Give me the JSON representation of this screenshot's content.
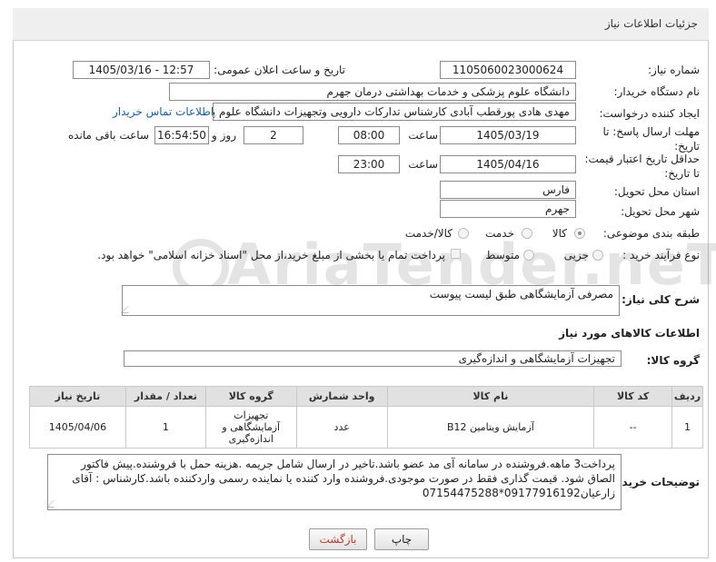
{
  "header": {
    "title": "جزئیات اطلاعات نیاز"
  },
  "form": {
    "need_number_label": "شماره نیاز:",
    "need_number": "1105060023000624",
    "announce_label": "تاریخ و ساعت اعلان عمومی:",
    "announce_value": "1405/03/16 - 12:57",
    "buyer_org_label": "نام دستگاه خریدار:",
    "buyer_org": "دانشگاه علوم پزشکی و خدمات بهداشتی  درمان جهرم",
    "requester_label": "ایجاد کننده درخواست:",
    "requester": "مهدی هادی پورقطب آبادی کارشناس تدارکات دارویی وتجهیزات دانشگاه علوم پز",
    "contact_link": "اطلاعات تماس خریدار",
    "reply_deadline_label_1": "مهلت ارسال پاسخ: تا",
    "reply_deadline_label_2": "تاریخ:",
    "reply_date": "1405/03/19",
    "time_label": "ساعت",
    "reply_time": "08:00",
    "days_value": "2",
    "days_label": "روز و",
    "remaining_time": "16:54:50",
    "remaining_label": "ساعت باقی مانده",
    "price_deadline_label_1": "حداقل تاریخ اعتبار قیمت:",
    "price_deadline_label_2": "تا تاریخ:",
    "price_date": "1405/04/16",
    "price_time": "23:00",
    "province_label": "استان محل تحویل:",
    "province": "فارس",
    "city_label": "شهر محل تحویل:",
    "city": "جهرم",
    "category_label": "طبقه بندی موضوعی:",
    "category_options": [
      "کالا",
      "خدمت",
      "کالا/خدمت"
    ],
    "category_selected": "کالا",
    "process_label": "نوع فرآیند خرید :",
    "process_options": [
      "جزیی",
      "متوسط"
    ],
    "payment_note": "پرداخت تمام یا بخشی از مبلغ خرید،از محل \"اسناد خزانه اسلامی\" خواهد بود."
  },
  "summary": {
    "label": "شرح کلی نیاز:",
    "value": "مصرفی آزمایشگاهی طبق لیست پیوست"
  },
  "goods_info_title": "اطلاعات کالاهای مورد نیاز",
  "goods_group": {
    "label": "گروه کالا:",
    "value": "تجهیزات آزمایشگاهی و اندازه‌گیری"
  },
  "table": {
    "headers": [
      "ردیف",
      "کد کالا",
      "نام کالا",
      "واحد شمارش",
      "گروه کالا",
      "تعداد / مقدار",
      "تاریخ نیاز"
    ],
    "rows": [
      [
        "1",
        "--",
        "آزمایش ویتامین B12",
        "عدد",
        "تجهیزات آزمایشگاهی و اندازه‌گیری",
        "1",
        "1405/04/06"
      ]
    ]
  },
  "buyer_notes": {
    "label": "توضیحات خریدار:",
    "value": "پرداخت3 ماهه.فروشنده در سامانه آی مد عضو باشد.تاخیر در ارسال شامل جریمه .هزینه حمل با فروشنده.پیش فاکتور الصاق شود. قیمت گذاری فقط در صورت موجودی.فروشنده وارد کننده یا نماینده رسمی واردکننده باشد.کارشناس : آقای زارعیان09177916192*07154475288"
  },
  "buttons": {
    "print": "چاپ",
    "back": "بازگشت"
  },
  "watermark": "AriaTender.neT"
}
